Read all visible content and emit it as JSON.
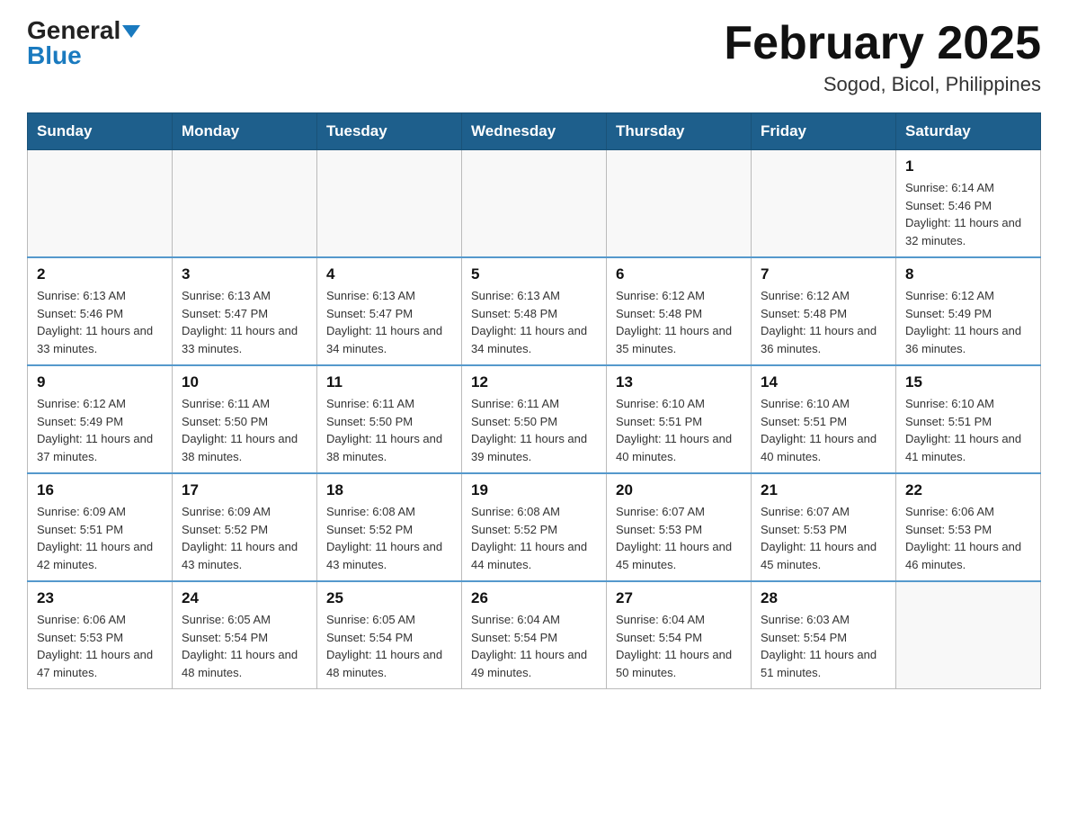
{
  "header": {
    "logo_general": "General",
    "logo_blue": "Blue",
    "title": "February 2025",
    "subtitle": "Sogod, Bicol, Philippines"
  },
  "days_of_week": [
    "Sunday",
    "Monday",
    "Tuesday",
    "Wednesday",
    "Thursday",
    "Friday",
    "Saturday"
  ],
  "weeks": [
    [
      {
        "day": "",
        "info": ""
      },
      {
        "day": "",
        "info": ""
      },
      {
        "day": "",
        "info": ""
      },
      {
        "day": "",
        "info": ""
      },
      {
        "day": "",
        "info": ""
      },
      {
        "day": "",
        "info": ""
      },
      {
        "day": "1",
        "info": "Sunrise: 6:14 AM\nSunset: 5:46 PM\nDaylight: 11 hours and 32 minutes."
      }
    ],
    [
      {
        "day": "2",
        "info": "Sunrise: 6:13 AM\nSunset: 5:46 PM\nDaylight: 11 hours and 33 minutes."
      },
      {
        "day": "3",
        "info": "Sunrise: 6:13 AM\nSunset: 5:47 PM\nDaylight: 11 hours and 33 minutes."
      },
      {
        "day": "4",
        "info": "Sunrise: 6:13 AM\nSunset: 5:47 PM\nDaylight: 11 hours and 34 minutes."
      },
      {
        "day": "5",
        "info": "Sunrise: 6:13 AM\nSunset: 5:48 PM\nDaylight: 11 hours and 34 minutes."
      },
      {
        "day": "6",
        "info": "Sunrise: 6:12 AM\nSunset: 5:48 PM\nDaylight: 11 hours and 35 minutes."
      },
      {
        "day": "7",
        "info": "Sunrise: 6:12 AM\nSunset: 5:48 PM\nDaylight: 11 hours and 36 minutes."
      },
      {
        "day": "8",
        "info": "Sunrise: 6:12 AM\nSunset: 5:49 PM\nDaylight: 11 hours and 36 minutes."
      }
    ],
    [
      {
        "day": "9",
        "info": "Sunrise: 6:12 AM\nSunset: 5:49 PM\nDaylight: 11 hours and 37 minutes."
      },
      {
        "day": "10",
        "info": "Sunrise: 6:11 AM\nSunset: 5:50 PM\nDaylight: 11 hours and 38 minutes."
      },
      {
        "day": "11",
        "info": "Sunrise: 6:11 AM\nSunset: 5:50 PM\nDaylight: 11 hours and 38 minutes."
      },
      {
        "day": "12",
        "info": "Sunrise: 6:11 AM\nSunset: 5:50 PM\nDaylight: 11 hours and 39 minutes."
      },
      {
        "day": "13",
        "info": "Sunrise: 6:10 AM\nSunset: 5:51 PM\nDaylight: 11 hours and 40 minutes."
      },
      {
        "day": "14",
        "info": "Sunrise: 6:10 AM\nSunset: 5:51 PM\nDaylight: 11 hours and 40 minutes."
      },
      {
        "day": "15",
        "info": "Sunrise: 6:10 AM\nSunset: 5:51 PM\nDaylight: 11 hours and 41 minutes."
      }
    ],
    [
      {
        "day": "16",
        "info": "Sunrise: 6:09 AM\nSunset: 5:51 PM\nDaylight: 11 hours and 42 minutes."
      },
      {
        "day": "17",
        "info": "Sunrise: 6:09 AM\nSunset: 5:52 PM\nDaylight: 11 hours and 43 minutes."
      },
      {
        "day": "18",
        "info": "Sunrise: 6:08 AM\nSunset: 5:52 PM\nDaylight: 11 hours and 43 minutes."
      },
      {
        "day": "19",
        "info": "Sunrise: 6:08 AM\nSunset: 5:52 PM\nDaylight: 11 hours and 44 minutes."
      },
      {
        "day": "20",
        "info": "Sunrise: 6:07 AM\nSunset: 5:53 PM\nDaylight: 11 hours and 45 minutes."
      },
      {
        "day": "21",
        "info": "Sunrise: 6:07 AM\nSunset: 5:53 PM\nDaylight: 11 hours and 45 minutes."
      },
      {
        "day": "22",
        "info": "Sunrise: 6:06 AM\nSunset: 5:53 PM\nDaylight: 11 hours and 46 minutes."
      }
    ],
    [
      {
        "day": "23",
        "info": "Sunrise: 6:06 AM\nSunset: 5:53 PM\nDaylight: 11 hours and 47 minutes."
      },
      {
        "day": "24",
        "info": "Sunrise: 6:05 AM\nSunset: 5:54 PM\nDaylight: 11 hours and 48 minutes."
      },
      {
        "day": "25",
        "info": "Sunrise: 6:05 AM\nSunset: 5:54 PM\nDaylight: 11 hours and 48 minutes."
      },
      {
        "day": "26",
        "info": "Sunrise: 6:04 AM\nSunset: 5:54 PM\nDaylight: 11 hours and 49 minutes."
      },
      {
        "day": "27",
        "info": "Sunrise: 6:04 AM\nSunset: 5:54 PM\nDaylight: 11 hours and 50 minutes."
      },
      {
        "day": "28",
        "info": "Sunrise: 6:03 AM\nSunset: 5:54 PM\nDaylight: 11 hours and 51 minutes."
      },
      {
        "day": "",
        "info": ""
      }
    ]
  ]
}
